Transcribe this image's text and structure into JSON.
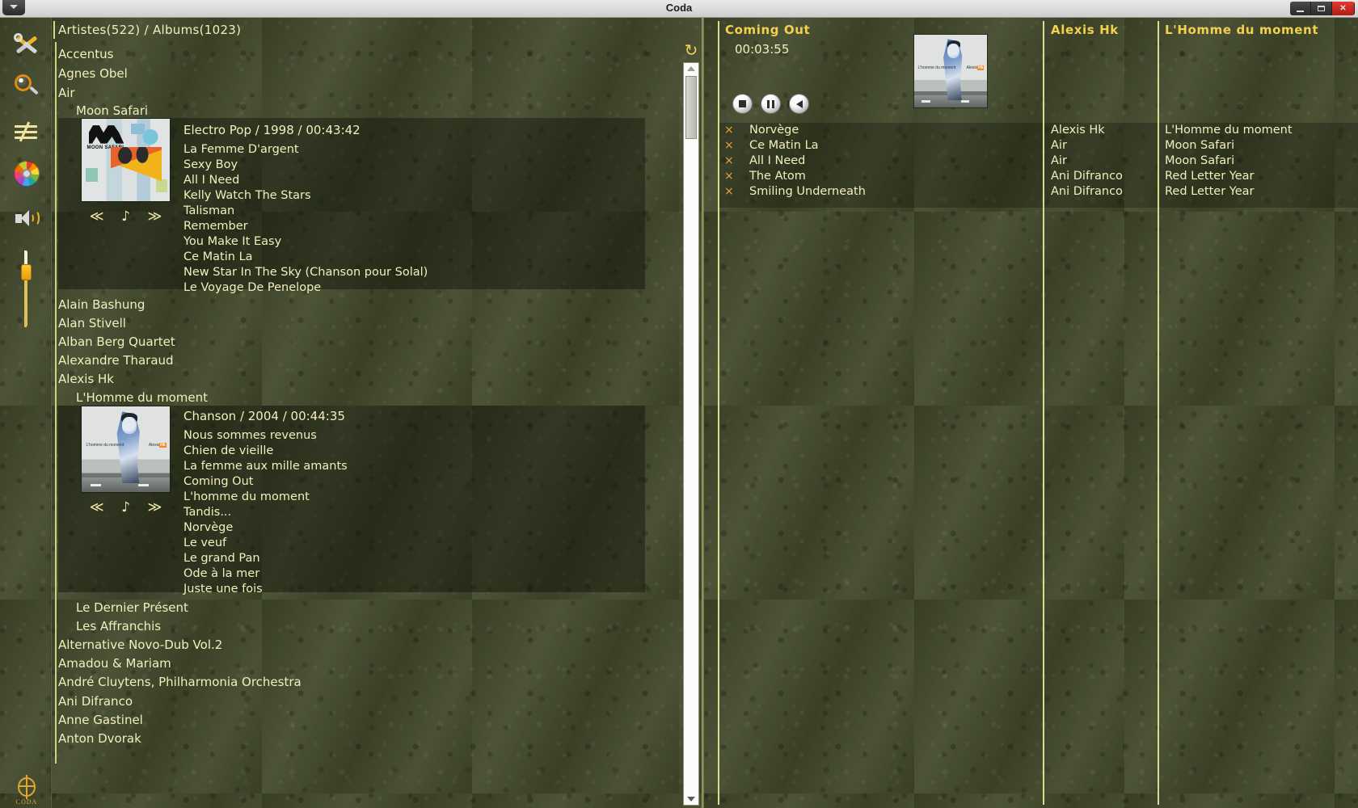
{
  "window": {
    "title": "Coda",
    "menu_icon": "window-menu-icon",
    "controls": {
      "minimize": "–",
      "maximize": "▭",
      "close": "X"
    }
  },
  "toolbar": {
    "items": [
      {
        "name": "tools-icon",
        "label": "Tools"
      },
      {
        "name": "search-icon",
        "label": "Search"
      },
      {
        "name": "equalizer-icon",
        "label": "Equalizer"
      },
      {
        "name": "disc-icon",
        "label": "Disc"
      },
      {
        "name": "speaker-icon",
        "label": "Volume"
      }
    ],
    "volume_slider": {
      "name": "volume-slider",
      "value": 82
    },
    "logo": {
      "name": "coda-logo",
      "text": "CODA"
    }
  },
  "library": {
    "header": "Artistes(522) / Albums(1023)",
    "refresh_icon": "refresh-icon",
    "entries": [
      {
        "type": "artist",
        "label": "Accentus"
      },
      {
        "type": "artist",
        "label": "Agnes Obel"
      },
      {
        "type": "artist",
        "label": "Air"
      },
      {
        "type": "album",
        "label": "Moon Safari"
      },
      {
        "type": "artist",
        "label": "Alain Bashung"
      },
      {
        "type": "artist",
        "label": "Alan Stivell"
      },
      {
        "type": "artist",
        "label": "Alban Berg Quartet"
      },
      {
        "type": "artist",
        "label": "Alexandre Tharaud"
      },
      {
        "type": "artist",
        "label": "Alexis Hk"
      },
      {
        "type": "album",
        "label": "L'Homme du moment"
      },
      {
        "type": "album",
        "label": "Le Dernier Présent"
      },
      {
        "type": "album",
        "label": "Les Affranchis"
      },
      {
        "type": "artist",
        "label": "Alternative Novo-Dub Vol.2"
      },
      {
        "type": "artist",
        "label": "Amadou & Mariam"
      },
      {
        "type": "artist",
        "label": "André Cluytens, Philharmonia Orchestra"
      },
      {
        "type": "artist",
        "label": "Ani Difranco"
      },
      {
        "type": "artist",
        "label": "Anne Gastinel"
      },
      {
        "type": "artist",
        "label": "Anton Dvorak"
      }
    ],
    "albums": [
      {
        "artist": "Air",
        "title": "Moon Safari",
        "meta": "Electro Pop / 1998 / 00:43:42",
        "cover_name": "album-cover-moon-safari",
        "controls": {
          "prev": "≪",
          "play": "♪",
          "next": "≫"
        },
        "tracks": [
          "La Femme D'argent",
          "Sexy Boy",
          "All I Need",
          "Kelly Watch The Stars",
          "Talisman",
          "Remember",
          "You Make It Easy",
          "Ce Matin La",
          "New Star In The Sky (Chanson pour Solal)",
          "Le Voyage De Penelope"
        ]
      },
      {
        "artist": "Alexis Hk",
        "title": "L'Homme du moment",
        "meta": "Chanson / 2004 / 00:44:35",
        "cover_name": "album-cover-lhomme-du-moment",
        "controls": {
          "prev": "≪",
          "play": "♪",
          "next": "≫"
        },
        "tracks": [
          "Nous sommes revenus",
          "Chien de vieille",
          "La femme aux mille amants",
          "Coming Out",
          "L'homme du moment",
          "Tandis...",
          "Norvège",
          "Le veuf",
          "Le grand Pan",
          "Ode à la mer",
          "Juste une fois"
        ]
      }
    ],
    "scrollbar": {
      "name": "library-scrollbar",
      "up": "▲",
      "down": "▼"
    }
  },
  "player": {
    "track_title": "Coming Out",
    "elapsed": "00:03:55",
    "cover_name": "now-playing-cover",
    "buttons": [
      {
        "name": "stop-button",
        "label": "Stop"
      },
      {
        "name": "pause-button",
        "label": "Pause"
      },
      {
        "name": "previous-button",
        "label": "Previous"
      }
    ]
  },
  "playlist": {
    "remove_icon": "×",
    "columns": {
      "title": "Coming Out",
      "artist": "Alexis Hk",
      "album": "L'Homme du moment"
    },
    "rows": [
      {
        "title": "Norvège",
        "artist": "Alexis Hk",
        "album": "L'Homme du moment"
      },
      {
        "title": "Ce Matin La",
        "artist": "Air",
        "album": "Moon Safari"
      },
      {
        "title": "All I Need",
        "artist": "Air",
        "album": "Moon Safari"
      },
      {
        "title": "The Atom",
        "artist": "Ani Difranco",
        "album": "Red Letter Year"
      },
      {
        "title": "Smiling Underneath",
        "artist": "Ani Difranco",
        "album": "Red Letter Year"
      }
    ]
  },
  "colors": {
    "background": "#434a2c",
    "text": "#f2efbe",
    "heading": "#f3d14e",
    "accent": "#e8a42b",
    "rule": "#dcdc8e"
  }
}
